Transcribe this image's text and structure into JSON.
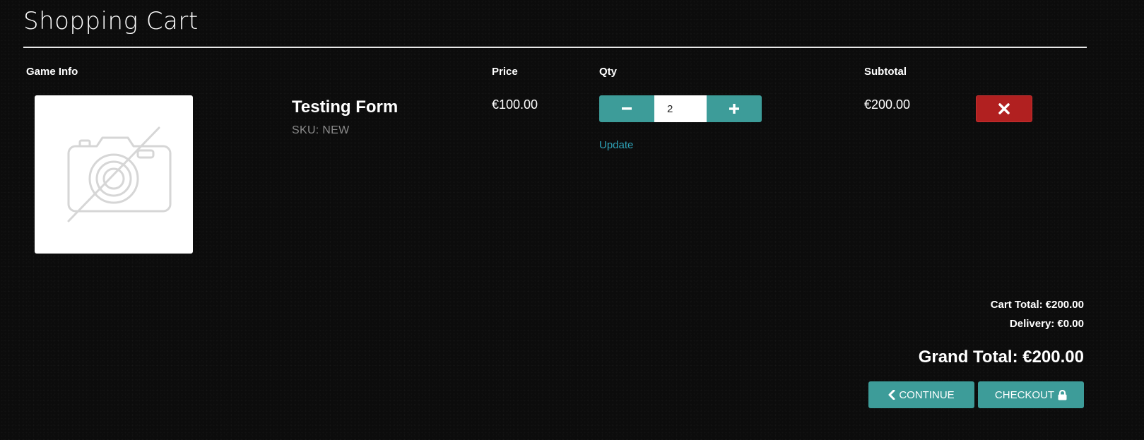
{
  "page": {
    "title": "Shopping Cart"
  },
  "table": {
    "headers": {
      "game_info": "Game Info",
      "price": "Price",
      "qty": "Qty",
      "subtotal": "Subtotal"
    }
  },
  "items": [
    {
      "name": "Testing Form",
      "sku": "SKU: NEW",
      "image_icon": "no-image-camera-icon",
      "price": "€100.00",
      "quantity": "2",
      "update_label": "Update",
      "subtotal": "€200.00",
      "remove_icon": "close-icon"
    }
  ],
  "summary": {
    "cart_total": "Cart Total: €200.00",
    "delivery": "Delivery: €0.00",
    "grand_total": "Grand Total: €200.00"
  },
  "actions": {
    "continue_label": "CONTINUE",
    "continue_icon": "chevron-left-icon",
    "checkout_label": "CHECKOUT",
    "checkout_icon": "lock-icon"
  },
  "colors": {
    "background": "#0c0c0c",
    "accent": "#3d9c99",
    "danger": "#b12020",
    "link": "#2fa3b8",
    "muted": "#8a8a8a"
  }
}
